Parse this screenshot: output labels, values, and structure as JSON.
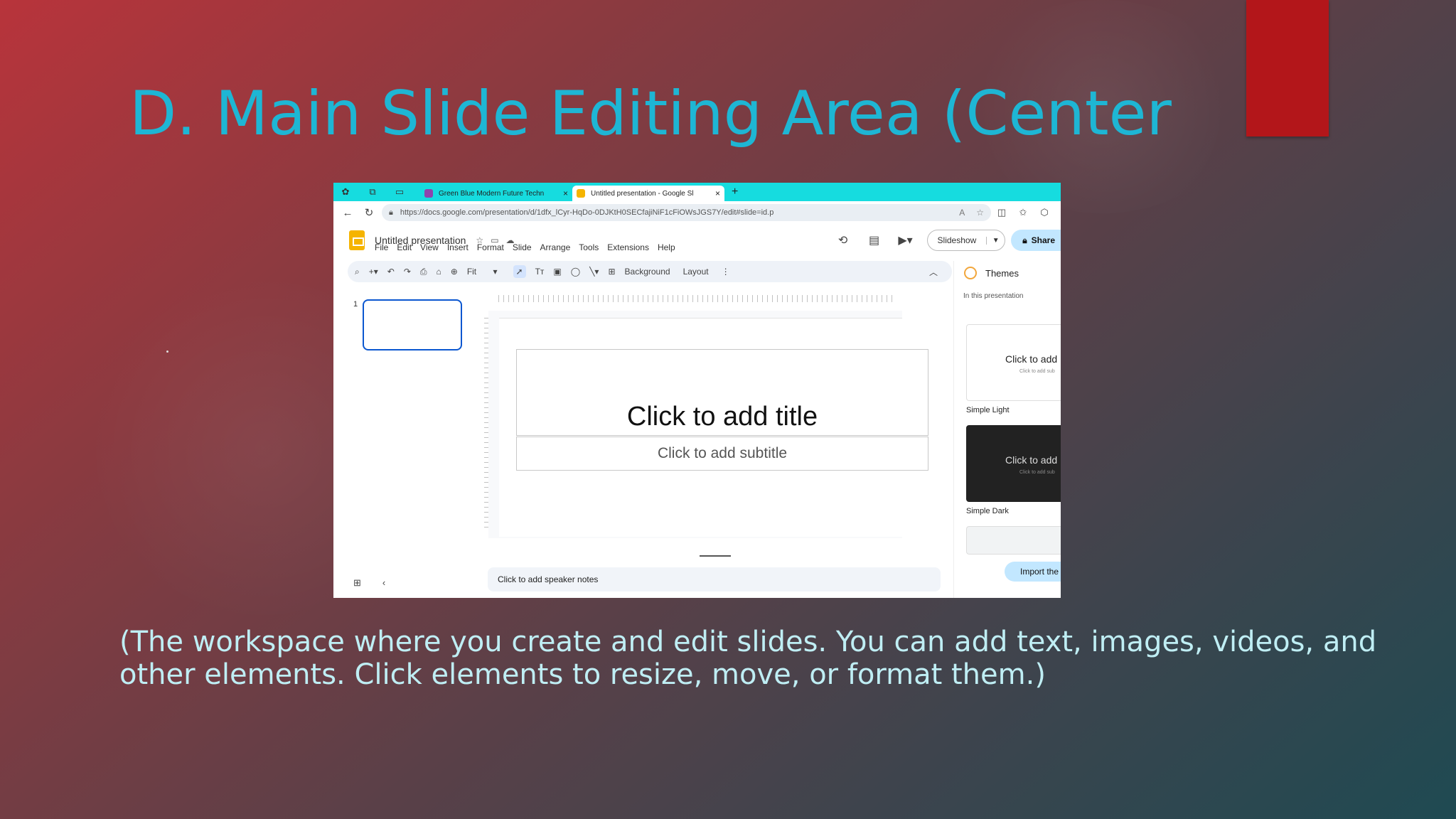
{
  "slide": {
    "title": "D. Main Slide Editing Area (Center",
    "caption": "(The workspace where you create and edit slides. You can add text, images, videos, and other elements. Click elements to resize, move, or format them.)",
    "accent_color": "#1eb6d4",
    "caption_color": "#bfeef4"
  },
  "browser": {
    "tabs": [
      {
        "label": "Green Blue Modern Future Techn",
        "active": false
      },
      {
        "label": "Untitled presentation - Google Sl",
        "active": true
      }
    ],
    "url": "https://docs.google.com/presentation/d/1dfx_lCyr-HqDo-0DJKtH0SECfajiNiF1cFiOWsJGS7Y/edit#slide=id.p"
  },
  "app": {
    "doc_title": "Untitled presentation",
    "menu": [
      "File",
      "Edit",
      "View",
      "Insert",
      "Format",
      "Slide",
      "Arrange",
      "Tools",
      "Extensions",
      "Help"
    ],
    "slideshow_label": "Slideshow",
    "share_label": "Share"
  },
  "toolbar": {
    "zoom": "Fit",
    "background_label": "Background",
    "layout_label": "Layout"
  },
  "filmstrip": {
    "slide_number": "1"
  },
  "editor": {
    "title_placeholder": "Click to add title",
    "subtitle_placeholder": "Click to add subtitle",
    "notes_placeholder": "Click to add speaker notes"
  },
  "themes": {
    "heading": "Themes",
    "subheading": "In this presentation",
    "cards": [
      {
        "name": "Simple Light",
        "preview_title": "Click to add",
        "preview_sub": "Click to add sub"
      },
      {
        "name": "Simple Dark",
        "preview_title": "Click to add",
        "preview_sub": "Click to add sub"
      }
    ],
    "import_label": "Import the"
  }
}
